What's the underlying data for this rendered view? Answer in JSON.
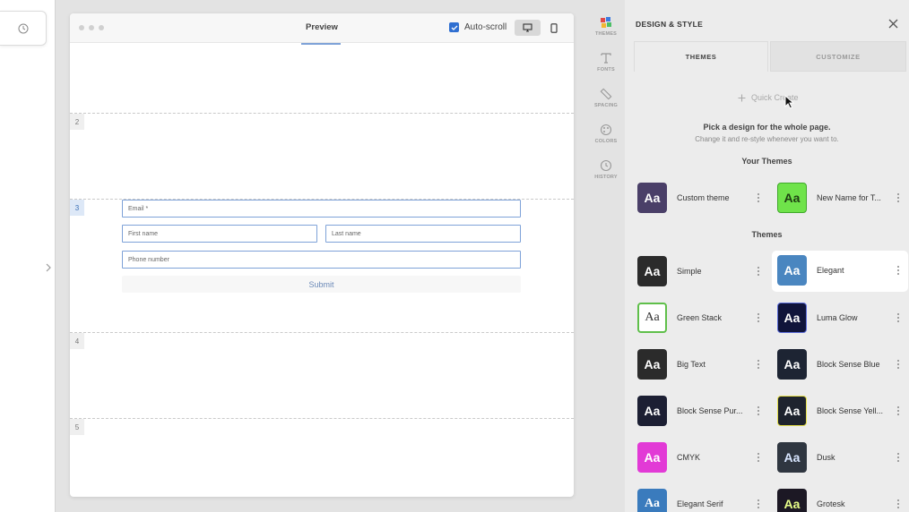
{
  "preview": {
    "title": "Preview",
    "autoscroll_label": "Auto-scroll",
    "sections": [
      "2",
      "3",
      "4",
      "5"
    ],
    "form": {
      "email": "Email *",
      "first_name": "First name",
      "last_name": "Last name",
      "phone": "Phone number",
      "submit": "Submit"
    }
  },
  "rail": {
    "themes": "THEMES",
    "fonts": "FONTS",
    "spacing": "SPACING",
    "colors": "COLORS",
    "history": "HISTORY"
  },
  "panel": {
    "title": "DESIGN & STYLE",
    "tabs": [
      "THEMES",
      "CUSTOMIZE"
    ],
    "quick_create": "Quick Create",
    "pick_heading": "Pick a design for the whole page.",
    "pick_sub": "Change it and re-style whenever you want to.",
    "your_themes_heading": "Your Themes",
    "themes_heading": "Themes",
    "swatch_text": "Aa",
    "your_themes": [
      {
        "name": "Custom theme",
        "bg": "#4a3f68",
        "fg": "#ffffff"
      },
      {
        "name": "New Name for T...",
        "bg": "#6fe34a",
        "fg": "#1e3d12"
      }
    ],
    "themes": [
      {
        "name": "Simple",
        "bg": "#2b2b2b",
        "fg": "#ffffff"
      },
      {
        "name": "Elegant",
        "bg": "#4a86c0",
        "fg": "#ffffff"
      },
      {
        "name": "Green Stack",
        "bg": "#ffffff",
        "fg": "#333333"
      },
      {
        "name": "Luma Glow",
        "bg": "#10143a",
        "fg": "#ffffff"
      },
      {
        "name": "Big Text",
        "bg": "#2b2b2b",
        "fg": "#ffffff"
      },
      {
        "name": "Block Sense Blue",
        "bg": "#1d2433",
        "fg": "#ffffff"
      },
      {
        "name": "Block Sense Pur...",
        "bg": "#1c1f33",
        "fg": "#ffffff"
      },
      {
        "name": "Block Sense Yell...",
        "bg": "#1e232e",
        "fg": "#ffffff"
      },
      {
        "name": "CMYK",
        "bg": "#e23ad6",
        "fg": "#ffffff"
      },
      {
        "name": "Dusk",
        "bg": "#2f3640",
        "fg": "#d8e6ff"
      },
      {
        "name": "Elegant Serif",
        "bg": "#3a7bbd",
        "fg": "#ffffff"
      },
      {
        "name": "Grotesk",
        "bg": "#1c1824",
        "fg": "#e8ff8a"
      }
    ]
  }
}
